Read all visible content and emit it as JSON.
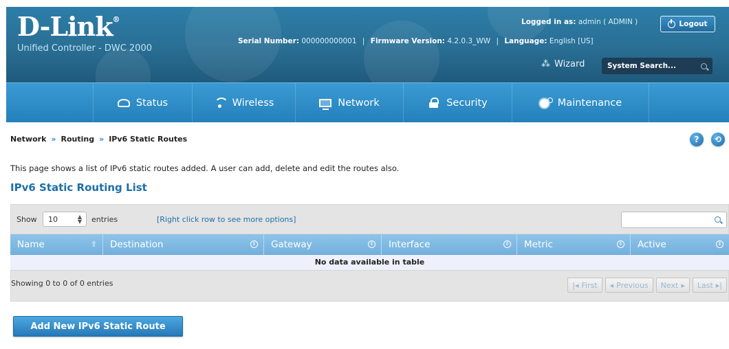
{
  "header": {
    "logo": "D-Link",
    "logo_mark": "®",
    "product": "Unified Controller - DWC 2000",
    "serial_label": "Serial Number:",
    "serial_value": "000000000001",
    "firmware_label": "Firmware Version:",
    "firmware_value": "4.2.0.3_WW",
    "language_label": "Language:",
    "language_value": "English [US]",
    "logged_label": "Logged in as:",
    "logged_value": "admin ( ADMIN )",
    "logout": "Logout",
    "wizard": "Wizard",
    "search_placeholder": "System Search..."
  },
  "nav": {
    "items": [
      {
        "label": "Status",
        "icon": "status-icon"
      },
      {
        "label": "Wireless",
        "icon": "wifi-icon"
      },
      {
        "label": "Network",
        "icon": "network-icon"
      },
      {
        "label": "Security",
        "icon": "lock-icon"
      },
      {
        "label": "Maintenance",
        "icon": "gear-icon"
      }
    ]
  },
  "breadcrumb": [
    "Network",
    "Routing",
    "IPv6 Static Routes"
  ],
  "help_icon": "?",
  "description": "This page shows a list of IPv6 static routes added. A user can add, delete and edit the routes also.",
  "section_title": "IPv6 Static Routing List",
  "table": {
    "show_label": "Show",
    "page_size": "10",
    "entries_label": "entries",
    "hint": "[Right click row to see more options]",
    "columns": [
      "Name",
      "Destination",
      "Gateway",
      "Interface",
      "Metric",
      "Active"
    ],
    "empty_message": "No data available in table",
    "info": "Showing 0 to 0 of 0 entries",
    "pager": {
      "first": "First",
      "previous": "Previous",
      "next": "Next",
      "last": "Last"
    }
  },
  "add_button": "Add New IPv6 Static Route",
  "colors": {
    "header_bg": "#2a6e94",
    "nav_bg": "#2580bb",
    "accent": "#1e6ea8",
    "table_header": "#80bbe3"
  }
}
